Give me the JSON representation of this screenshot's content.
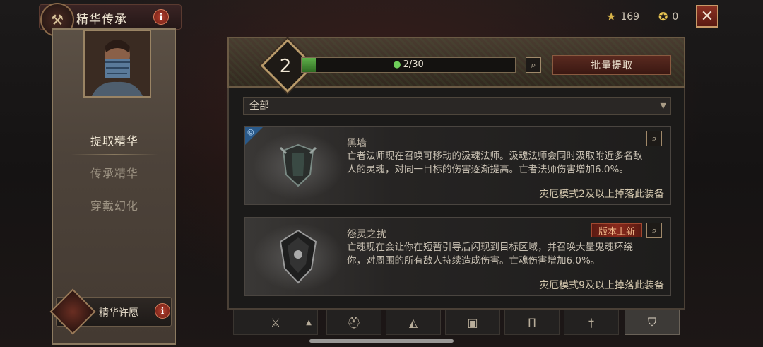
{
  "header": {
    "title": "精华传承",
    "info_glyph": "i"
  },
  "left_menu": {
    "items": [
      {
        "label": "提取精华",
        "active": true
      },
      {
        "label": "传承精华",
        "active": false
      },
      {
        "label": "穿戴幻化",
        "active": false
      }
    ],
    "wish_label": "精华许愿",
    "wish_info_glyph": "i"
  },
  "currencies": [
    {
      "icon": "star-icon",
      "value": "169"
    },
    {
      "icon": "gold-star-icon",
      "value": "0"
    }
  ],
  "close_glyph": "✕",
  "extract": {
    "level": "2",
    "progress_text": "2/30",
    "progress_fraction": 0.067,
    "batch_button": "批量提取",
    "filter_value": "全部"
  },
  "cards": [
    {
      "name": "黑墙",
      "description": "亡者法师现在召唤可移动的汲魂法师。汲魂法师会同时汲取附近多名敌人的灵魂，对同一目标的伤害逐渐提高。亡者法师伤害增加6.0%。",
      "drop_text": "灾厄模式2及以上掉落此装备",
      "badge": ""
    },
    {
      "name": "怨灵之扰",
      "description": "亡魂现在会让你在短暂引导后闪现到目标区域，并召唤大量鬼魂环绕你，对周围的所有敌人持续造成伤害。亡魂伤害增加6.0%。",
      "drop_text": "灾厄模式9及以上掉落此装备",
      "badge": "版本上新"
    }
  ],
  "bottom_tabs": [
    {
      "icon": "crossed-axes-icon",
      "glyph": "⚔",
      "active": false
    },
    {
      "icon": "helmet-icon",
      "glyph": "⛑",
      "active": false
    },
    {
      "icon": "shoulder-icon",
      "glyph": "◭",
      "active": false
    },
    {
      "icon": "chest-armor-icon",
      "glyph": "▣",
      "active": false
    },
    {
      "icon": "pants-icon",
      "glyph": "Π",
      "active": false
    },
    {
      "icon": "sword-icon",
      "glyph": "†",
      "active": false
    },
    {
      "icon": "shield-icon",
      "glyph": "⛉",
      "active": true
    }
  ],
  "colors": {
    "accent_red": "#8a3122",
    "progress_green": "#5fb04a",
    "gold_text": "#d3c7ae"
  }
}
